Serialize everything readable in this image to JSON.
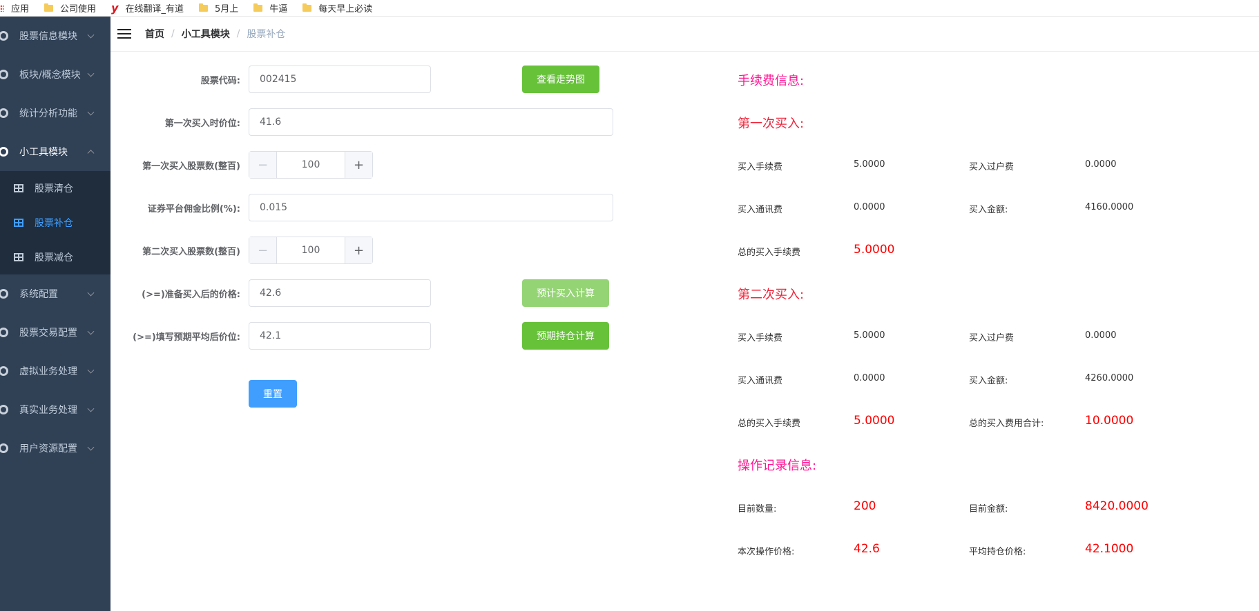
{
  "bookmarks": [
    {
      "label": "应用",
      "icon": "apps-icon"
    },
    {
      "label": "公司使用",
      "icon": "folder-icon"
    },
    {
      "label": "在线翻译_有道",
      "icon": "youdao-icon"
    },
    {
      "label": "5月上",
      "icon": "folder-icon"
    },
    {
      "label": "牛逼",
      "icon": "folder-icon"
    },
    {
      "label": "每天早上必读",
      "icon": "folder-icon"
    }
  ],
  "youdao_glyph": "y",
  "sidebar": {
    "items": [
      {
        "label": "股票信息模块"
      },
      {
        "label": "板块/概念模块"
      },
      {
        "label": "统计分析功能"
      },
      {
        "label": "小工具模块"
      },
      {
        "label": "系统配置"
      },
      {
        "label": "股票交易配置"
      },
      {
        "label": "虚拟业务处理"
      },
      {
        "label": "真实业务处理"
      },
      {
        "label": "用户资源配置"
      }
    ],
    "subitems": [
      {
        "label": "股票清仓"
      },
      {
        "label": "股票补仓"
      },
      {
        "label": "股票减仓"
      }
    ]
  },
  "breadcrumb": {
    "home": "首页",
    "module": "小工具模块",
    "current": "股票补仓",
    "separator": "/"
  },
  "form": {
    "code_label": "股票代码:",
    "code_value": "002415",
    "view_chart_button": "查看走势图",
    "first_price_label": "第一次买入时价位:",
    "first_price_value": "41.6",
    "first_qty_label": "第一次买入股票数(整百)",
    "first_qty_value": "100",
    "commission_label": "证券平台佣金比例(%):",
    "commission_value": "0.015",
    "second_qty_label": "第二次买入股票数(整百)",
    "second_qty_value": "100",
    "planned_price_label": "(>=)准备买入后的价格:",
    "planned_price_value": "42.6",
    "estimate_button": "预计买入计算",
    "expected_avg_label": "(>=)填写预期平均后价位:",
    "expected_avg_value": "42.1",
    "expected_hold_button": "预期持仓计算",
    "reset_button": "重置",
    "minus": "−",
    "plus": "+"
  },
  "fees": {
    "title": "手续费信息:",
    "first_title": "第一次买入:",
    "first": {
      "buy_fee_label": "买入手续费",
      "buy_fee": "5.0000",
      "transfer_fee_label": "买入过户费",
      "transfer_fee": "0.0000",
      "comm_fee_label": "买入通讯费",
      "comm_fee": "0.0000",
      "amount_label": "买入金额:",
      "amount": "4160.0000",
      "total_fee_label": "总的买入手续费",
      "total_fee": "5.0000"
    },
    "second_title": "第二次买入:",
    "second": {
      "buy_fee_label": "买入手续费",
      "buy_fee": "5.0000",
      "transfer_fee_label": "买入过户费",
      "transfer_fee": "0.0000",
      "comm_fee_label": "买入通讯费",
      "comm_fee": "0.0000",
      "amount_label": "买入金额:",
      "amount": "4260.0000",
      "total_fee_label": "总的买入手续费",
      "total_fee": "5.0000",
      "total_cost_label": "总的买入费用合计:",
      "total_cost": "10.0000"
    },
    "record_title": "操作记录信息:",
    "record": {
      "qty_label": "目前数量:",
      "qty": "200",
      "amount_label": "目前金额:",
      "amount": "8420.0000",
      "price_label": "本次操作价格:",
      "price": "42.6",
      "avg_label": "平均持仓价格:",
      "avg": "42.1000"
    }
  },
  "colors": {
    "sidebar_bg": "#304156",
    "submenu_bg": "#1f2d3d",
    "active": "#409eff",
    "green": "#67c23a",
    "heading_pink": "#ff1493",
    "value_red": "#ff0000"
  }
}
